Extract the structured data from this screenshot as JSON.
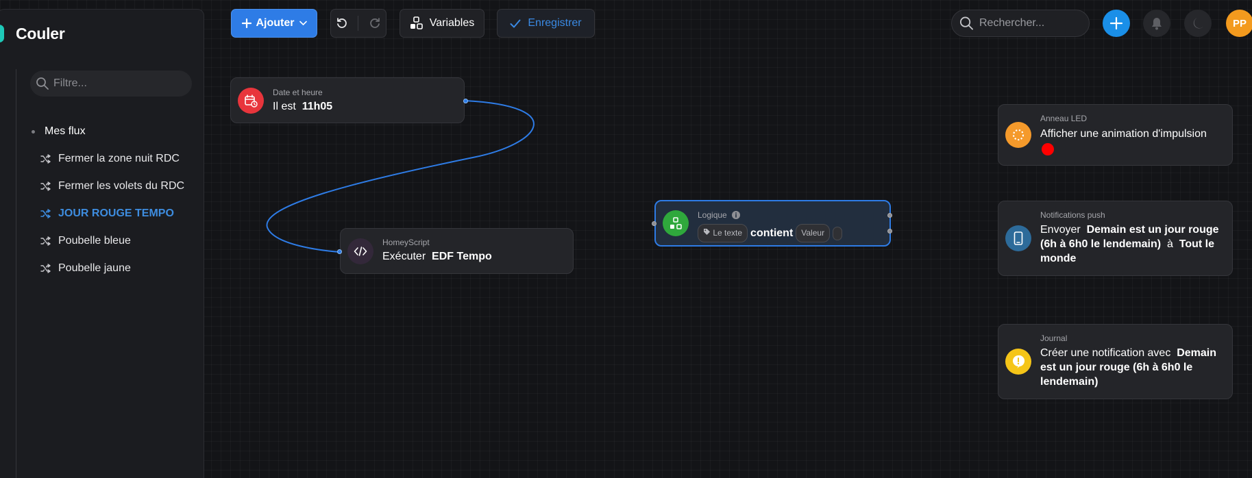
{
  "app": {
    "title": "Couler"
  },
  "sidebar": {
    "filter_placeholder": "Filtre...",
    "folder_label": "Mes flux",
    "flows": [
      {
        "label": "Fermer la zone nuit RDC",
        "active": false
      },
      {
        "label": "Fermer les volets du RDC",
        "active": false
      },
      {
        "label": "JOUR ROUGE TEMPO",
        "active": true
      },
      {
        "label": "Poubelle bleue",
        "active": false
      },
      {
        "label": "Poubelle jaune",
        "active": false
      }
    ]
  },
  "toolbar": {
    "add_label": "Ajouter",
    "variables_label": "Variables",
    "save_label": "Enregistrer",
    "search_placeholder": "Rechercher...",
    "avatar_initials": "PP"
  },
  "cards": {
    "date": {
      "category": "Date et heure",
      "text": "Il est",
      "value": "11h05"
    },
    "script": {
      "category": "HomeyScript",
      "text": "Exécuter",
      "value": "EDF Tempo"
    },
    "logic": {
      "category": "Logique",
      "chip_left": "Le texte",
      "text": "contient",
      "chip_right": "Valeur"
    },
    "led": {
      "category": "Anneau LED",
      "text": "Afficher une animation d'impulsion",
      "color": "#ff0000"
    },
    "push": {
      "category": "Notifications push",
      "text": "Envoyer",
      "value": "Demain est un jour rouge (6h à 6h0 le lendemain)",
      "connector": "à",
      "target": "Tout le monde"
    },
    "journal": {
      "category": "Journal",
      "text": "Créer une notification avec",
      "value": "Demain est un jour rouge (6h à 6h0 le lendemain)"
    }
  },
  "colors": {
    "accent": "#2e7ce6",
    "date_icon": "#e8353c",
    "logic_icon": "#2fa83c",
    "led_icon": "#f59a2b",
    "push_icon": "#2d6b9a",
    "journal_icon": "#f5c518"
  }
}
